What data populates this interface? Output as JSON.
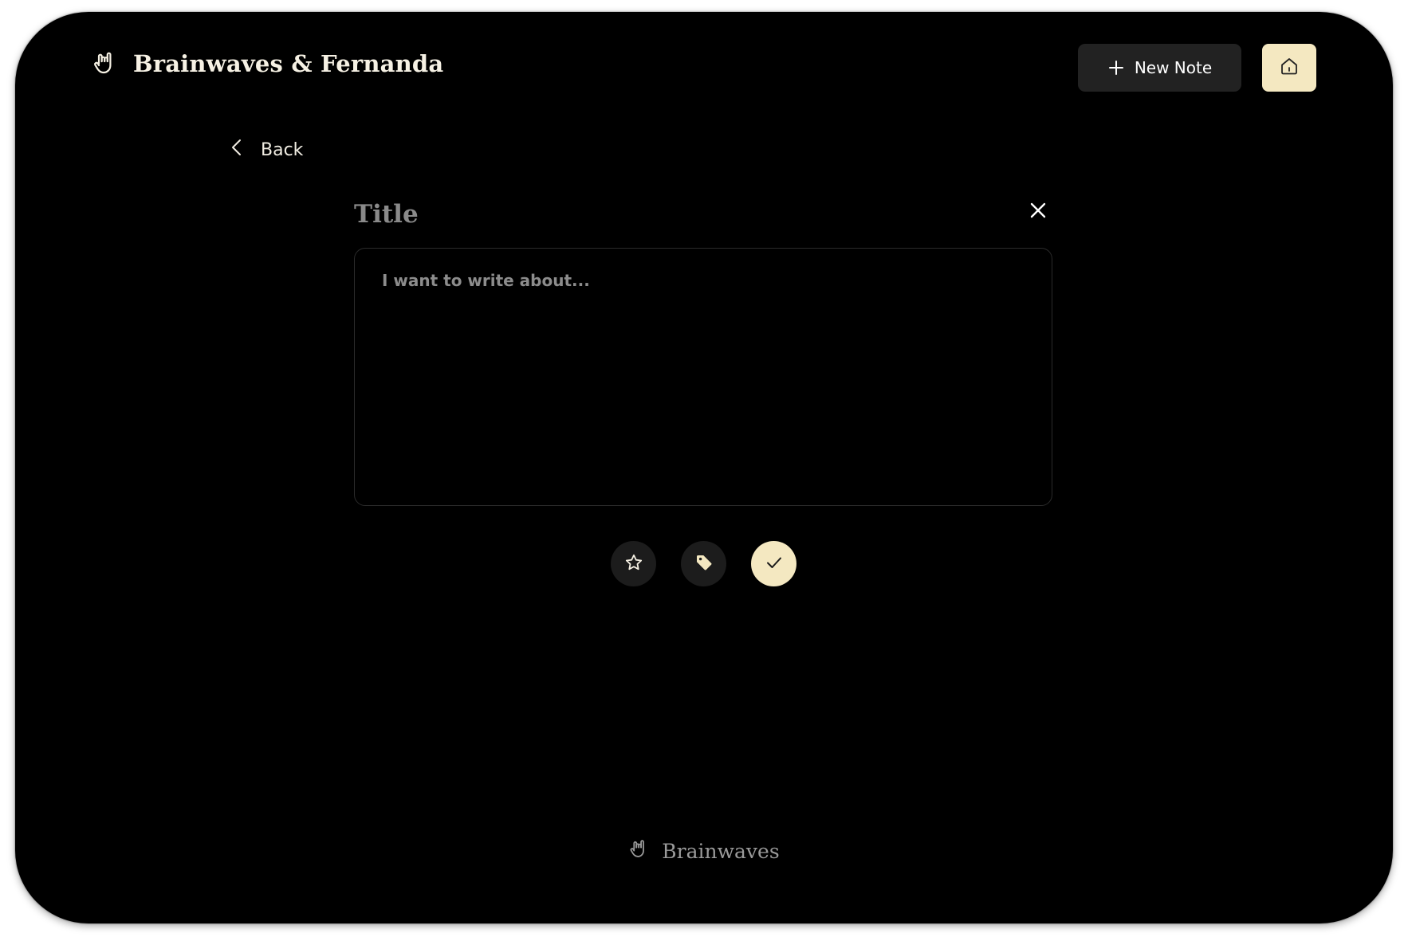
{
  "header": {
    "brand_title": "Brainwaves & Fernanda",
    "brand_icon": "hand-horns-icon",
    "new_note_label": "New Note",
    "new_note_icon": "plus-icon",
    "home_icon": "home-icon"
  },
  "nav": {
    "back_label": "Back",
    "back_icon": "chevron-left-icon"
  },
  "editor": {
    "title_placeholder": "Title",
    "title_value": "",
    "body_placeholder": "I want to write about...",
    "body_value": "",
    "close_icon": "close-icon"
  },
  "actions": {
    "favorite_icon": "star-icon",
    "tag_icon": "tag-icon",
    "save_icon": "check-icon"
  },
  "footer": {
    "brand_title": "Brainwaves",
    "brand_icon": "hand-horns-icon"
  },
  "colors": {
    "background": "#000000",
    "accent": "#F4E8C1",
    "button_dark": "#222222",
    "text_primary": "#F6F1E4",
    "text_muted": "#8C8C8C"
  }
}
